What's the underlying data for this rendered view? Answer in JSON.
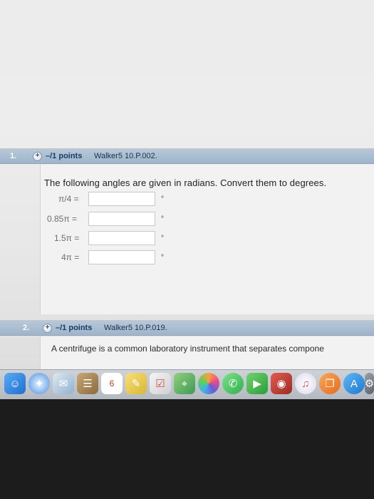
{
  "question1": {
    "number": "1.",
    "points": "–/1 points",
    "source": "Walker5 10.P.002.",
    "prompt": "The following angles are given in radians. Convert them to degrees.",
    "rows": [
      {
        "label": "π/4 =",
        "value": "",
        "unit": "°"
      },
      {
        "label": "0.85π =",
        "value": "",
        "unit": "°"
      },
      {
        "label": "1.5π =",
        "value": "",
        "unit": "°"
      },
      {
        "label": "4π =",
        "value": "",
        "unit": "°"
      }
    ]
  },
  "question2": {
    "number": "2.",
    "points": "–/1 points",
    "source": "Walker5 10.P.019.",
    "text": "A centrifuge is a common laboratory instrument that separates compone"
  },
  "dock": {
    "icons": [
      "finder-icon",
      "safari-icon",
      "mail-icon",
      "contacts-icon",
      "calendar-icon",
      "notes-icon",
      "reminders-icon",
      "maps-icon",
      "photos-icon",
      "messages-icon",
      "facetime-icon",
      "photo-booth-icon",
      "itunes-icon",
      "ibooks-icon",
      "app-store-icon",
      "system-preferences-icon"
    ]
  }
}
